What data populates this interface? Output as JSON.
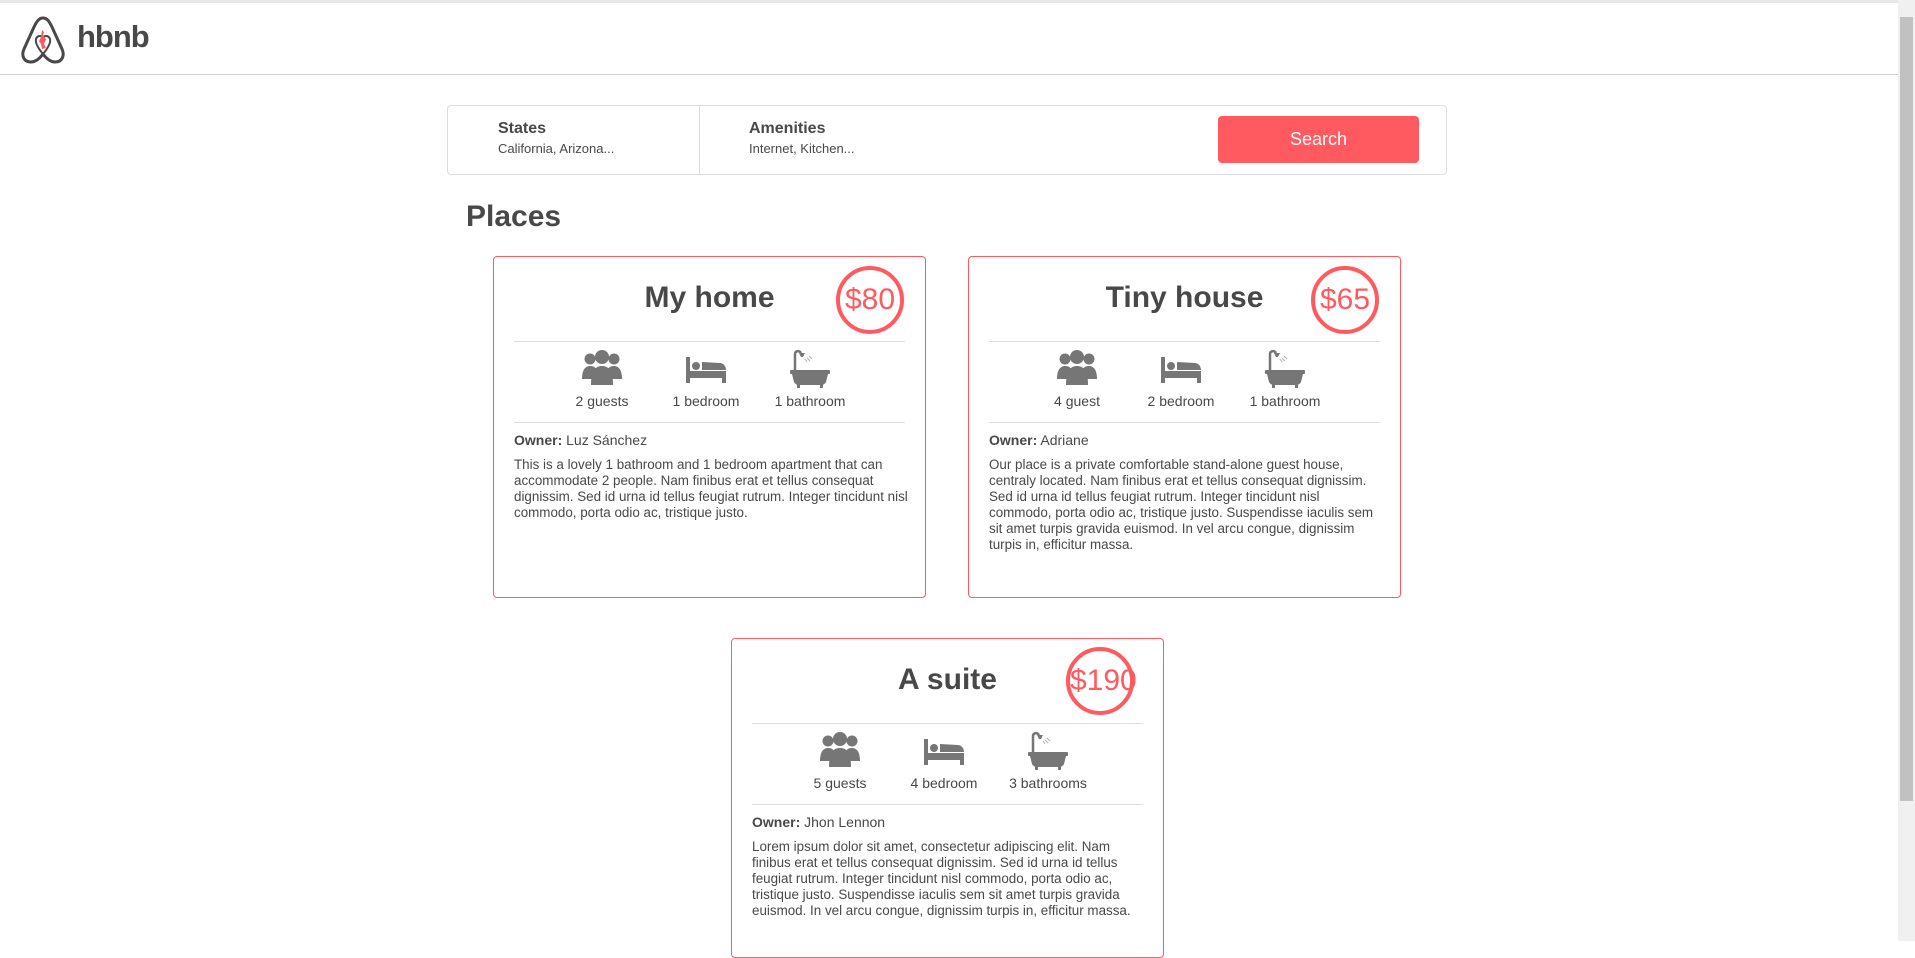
{
  "brand": {
    "name": "hbnb"
  },
  "filters": {
    "states": {
      "title": "States",
      "selected": "California, Arizona..."
    },
    "amenities": {
      "title": "Amenities",
      "selected": "Internet, Kitchen..."
    },
    "search_label": "Search"
  },
  "places_title": "Places",
  "owner_label": "Owner:",
  "places": [
    {
      "title": "My home",
      "price": "$80",
      "guests": "2 guests",
      "rooms": "1 bedroom",
      "baths": "1 bathroom",
      "owner": "Luz Sánchez",
      "description": "This is a lovely 1 bathroom and 1 bedroom apartment that can accommodate 2 people. Nam finibus erat et tellus consequat dignissim. Sed id urna id tellus feugiat rutrum. Integer tincidunt nisl commodo, porta odio ac, tristique justo."
    },
    {
      "title": "Tiny house",
      "price": "$65",
      "guests": "4 guest",
      "rooms": "2 bedroom",
      "baths": "1 bathroom",
      "owner": "Adriane",
      "description": "Our place is a private comfortable stand-alone guest house, centraly located. Nam finibus erat et tellus consequat dignissim. Sed id urna id tellus feugiat rutrum. Integer tincidunt nisl commodo, porta odio ac, tristique justo. Suspendisse iaculis sem sit amet turpis gravida euismod. In vel arcu congue, dignissim turpis in, efficitur massa."
    },
    {
      "title": "A suite",
      "price": "$190",
      "guests": "5 guests",
      "rooms": "4 bedroom",
      "baths": "3 bathrooms",
      "owner": "Jhon Lennon",
      "description": "Lorem ipsum dolor sit amet, consectetur adipiscing elit. Nam finibus erat et tellus consequat dignissim. Sed id urna id tellus feugiat rutrum. Integer tincidunt nisl commodo, porta odio ac, tristique justo. Suspendisse iaculis sem sit amet turpis gravida euismod. In vel arcu congue, dignissim turpis in, efficitur massa."
    }
  ],
  "icons": {
    "logo": "airbnb-logo-icon",
    "guests": "group-icon",
    "rooms": "bed-icon",
    "baths": "bathtub-icon"
  },
  "colors": {
    "accent": "#FF5A5F",
    "text": "#484848",
    "border": "#dddddd"
  }
}
